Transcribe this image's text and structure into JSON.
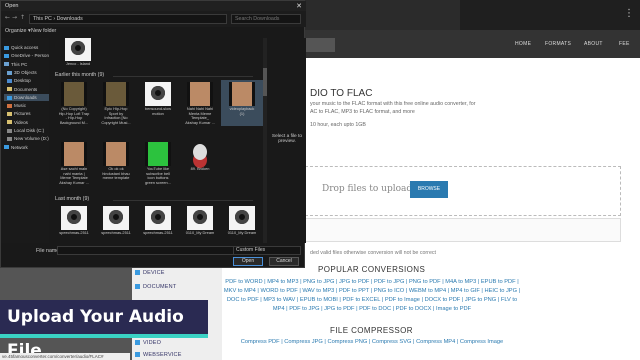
{
  "dialog": {
    "title": "Open",
    "close_glyph": "✕",
    "breadcrumb": [
      "This PC",
      "Downloads"
    ],
    "search_placeholder": "Search Downloads",
    "organize_label": "Organize ▾",
    "new_folder_label": "New folder",
    "nav_items": [
      {
        "label": "Quick access",
        "icon": "star-icon",
        "color": "#3a9ae0"
      },
      {
        "label": "OneDrive - Personal",
        "icon": "cloud-icon",
        "color": "#3a9ae0"
      },
      {
        "label": "This PC",
        "icon": "computer-icon",
        "color": "#6aa0d0"
      },
      {
        "label": "3D Objects",
        "icon": "cube-icon",
        "color": "#6aa0d0"
      },
      {
        "label": "Desktop",
        "icon": "folder-icon",
        "color": "#4a8ad0"
      },
      {
        "label": "Documents",
        "icon": "folder-icon",
        "color": "#d8c070"
      },
      {
        "label": "Downloads",
        "icon": "download-icon",
        "color": "#3a9ae0",
        "selected": true
      },
      {
        "label": "Music",
        "icon": "music-icon",
        "color": "#d07040"
      },
      {
        "label": "Pictures",
        "icon": "picture-icon",
        "color": "#d8c070"
      },
      {
        "label": "Videos",
        "icon": "video-icon",
        "color": "#d8c070"
      },
      {
        "label": "Local Disk (C:)",
        "icon": "drive-icon",
        "color": "#888888"
      },
      {
        "label": "New Volume (D:)",
        "icon": "drive-icon",
        "color": "#888888"
      },
      {
        "label": "Network",
        "icon": "network-icon",
        "color": "#3a9ae0"
      }
    ],
    "top_file": {
      "caption": "Jenco - Island",
      "kind": "vlc"
    },
    "groups": [
      {
        "label": "Earlier this month (9)",
        "files": [
          {
            "caption": "(No Copyright)\nHip-Hop Lofi Trap\n- Hip-Hop\nBackground M...",
            "kind": "vid"
          },
          {
            "caption": "Epic Hip-Hop\nSport by\nInfraction [No\nCopyright Musi...",
            "kind": "vid"
          },
          {
            "caption": "bensound-slow\nmotion",
            "kind": "vlc"
          },
          {
            "caption": "Nahi Nahi Nahi\nMenta Meme\nTemplate_\nAkshay Kumar ...",
            "kind": "vid2"
          },
          {
            "caption": "videoplayback\n(1)",
            "kind": "vid2",
            "selected": true
          },
          {
            "caption": "Ase sachi main\nnahi manta |\nMeme Template\nAkshay Kumar ...",
            "kind": "vid2"
          },
          {
            "caption": "Ok ok ok\nhindustani bhau\nmeme template",
            "kind": "vid2"
          },
          {
            "caption": "YouTube like\nsubscribe bell\nicon buttons\ngreen screen...",
            "kind": "grn"
          },
          {
            "caption": "89. Broken",
            "kind": "ff"
          }
        ]
      },
      {
        "label": "Last month (9)",
        "files": [
          {
            "caption": "speechmas-2511",
            "kind": "vlc"
          },
          {
            "caption": "speechmas-2511",
            "kind": "vlc"
          },
          {
            "caption": "speechmas-2511",
            "kind": "vlc"
          },
          {
            "caption": "0110_My Dream",
            "kind": "vlc"
          },
          {
            "caption": "0110_My Dream",
            "kind": "vlc"
          }
        ]
      }
    ],
    "preview_text": "Select a file to\npreview.",
    "file_name_label": "File name:",
    "file_type_value": "Custom Files",
    "open_label": "Open",
    "cancel_label": "Cancel"
  },
  "site": {
    "nav": [
      "HOME",
      "FORMATS",
      "ABOUT",
      "FEE"
    ],
    "heading": "DIO TO FLAC",
    "intro_lines": [
      "your music to the FLAC format with this free online audio converter, for",
      "AC to FLAC, MP3 to FLAC format, and more"
    ],
    "limit_text": "10 hour, each upto 1GB",
    "drop_text": "Drop files to upload, or",
    "browse_label": "BROWSE",
    "warning": "ded valid files otherwise conversion will not be correct",
    "side_items": [
      "DEVICE",
      "DOCUMENT",
      "VIDEO",
      "WEBSERVICE"
    ],
    "popular_heading": "POPULAR CONVERSIONS",
    "popular_links": "PDF to WORD | MP4 to MP3 | PNG to JPG | JPG to PDF | PDF to JPG | PNG to PDF | M4A to MP3 | EPUB to PDF | MKV to MP4 | WORD to PDF | WAV to MP3 | PDF to PPT | PNG to ICO | WEBM to MP4 | MP4 to GIF | HEIC to JPG | DOC to PDF | MP3 to WAV | EPUB to MOBI | PDF to EXCEL | PDF to Image | DOCX to PDF | JPG to PNG | FLV to MP4 | PDF to JPG | JPG to PDF | PDF to DOC | PDF to DOCX | Image to PDF",
    "compressor_heading": "FILE COMPRESSOR",
    "compressor_links": "Compress PDF | Compress JPG | Compress PNG | Compress SVG | Compress MP4 | Compress Image"
  },
  "banner": {
    "text": "Upload Your Audio File"
  },
  "statusbar": {
    "url": "ve.45famousconverter.com/converter/audio/FLAC#"
  }
}
